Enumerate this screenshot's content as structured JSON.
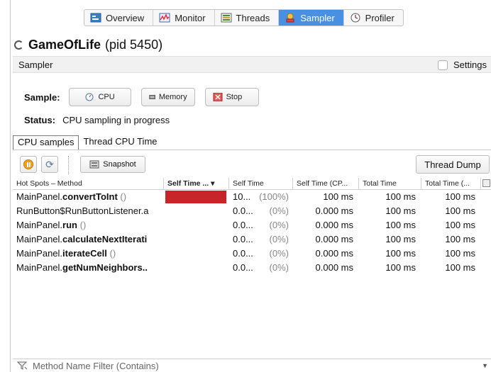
{
  "tabs": [
    {
      "label": "Overview",
      "icon": "overview-icon"
    },
    {
      "label": "Monitor",
      "icon": "monitor-icon"
    },
    {
      "label": "Threads",
      "icon": "threads-icon"
    },
    {
      "label": "Sampler",
      "icon": "sampler-icon",
      "active": true
    },
    {
      "label": "Profiler",
      "icon": "profiler-icon"
    }
  ],
  "app": {
    "name": "GameOfLife",
    "pid": "(pid 5450)"
  },
  "sampler_bar": {
    "label": "Sampler",
    "settings_label": "Settings"
  },
  "sample": {
    "label": "Sample:",
    "cpu_label": "CPU",
    "memory_label": "Memory",
    "stop_label": "Stop"
  },
  "status": {
    "label": "Status:",
    "value": "CPU sampling in progress"
  },
  "inner_tabs": {
    "cpu_samples": "CPU samples",
    "thread_cpu_time": "Thread CPU Time"
  },
  "toolbar": {
    "snapshot_label": "Snapshot",
    "thread_dump_label": "Thread Dump"
  },
  "table": {
    "headers": [
      "Hot Spots – Method",
      "Self Time ...",
      "Self Time",
      "Self Time (CP...",
      "Total Time",
      "Total Time (..."
    ],
    "rows": [
      {
        "cls": "MainPanel.",
        "method": "convertToInt",
        "suffix": " ()",
        "self_bar": 1.0,
        "self_time": "10...",
        "self_pct": "(100%)",
        "self_cpu": "100 ms",
        "total": "100 ms",
        "total_cpu": "100 ms"
      },
      {
        "cls": "RunButton$RunButtonListener.a",
        "method": "",
        "suffix": "",
        "self_bar": 0,
        "self_time": "0.0...",
        "self_pct": "(0%)",
        "self_cpu": "0.000 ms",
        "total": "100 ms",
        "total_cpu": "100 ms"
      },
      {
        "cls": "MainPanel.",
        "method": "run",
        "suffix": " ()",
        "self_bar": 0,
        "self_time": "0.0...",
        "self_pct": "(0%)",
        "self_cpu": "0.000 ms",
        "total": "100 ms",
        "total_cpu": "100 ms"
      },
      {
        "cls": "MainPanel.",
        "method": "calculateNextIterati",
        "suffix": "",
        "self_bar": 0,
        "self_time": "0.0...",
        "self_pct": "(0%)",
        "self_cpu": "0.000 ms",
        "total": "100 ms",
        "total_cpu": "100 ms"
      },
      {
        "cls": "MainPanel.",
        "method": "iterateCell",
        "suffix": " ()",
        "self_bar": 0,
        "self_time": "0.0...",
        "self_pct": "(0%)",
        "self_cpu": "0.000 ms",
        "total": "100 ms",
        "total_cpu": "100 ms"
      },
      {
        "cls": "MainPanel.",
        "method": "getNumNeighbors..",
        "suffix": "",
        "self_bar": 0,
        "self_time": "0.0...",
        "self_pct": "(0%)",
        "self_cpu": "0.000 ms",
        "total": "100 ms",
        "total_cpu": "100 ms"
      }
    ]
  },
  "filter": {
    "placeholder": "Method Name Filter (Contains)"
  },
  "colors": {
    "accent": "#4a90e2",
    "bar": "#c8252a"
  }
}
